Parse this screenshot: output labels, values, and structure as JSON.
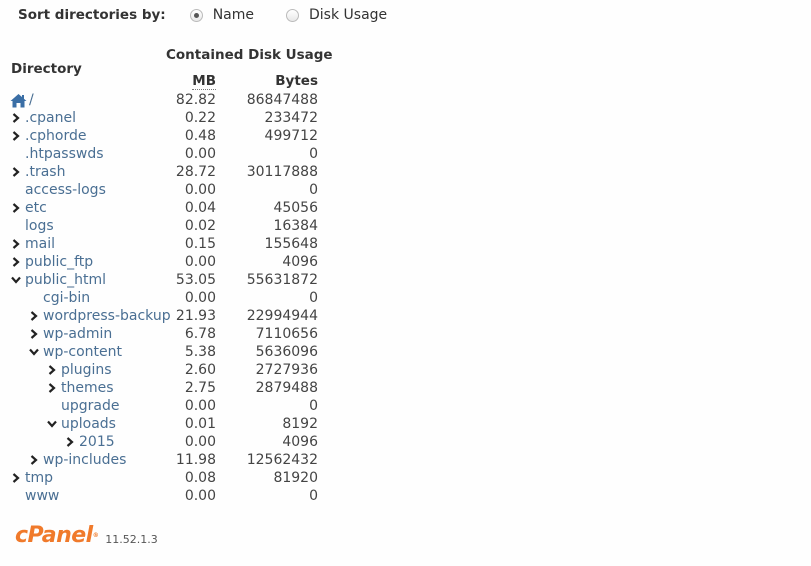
{
  "sort": {
    "label": "Sort directories by:",
    "options": [
      {
        "label": "Name",
        "checked": true
      },
      {
        "label": "Disk Usage",
        "checked": false
      }
    ]
  },
  "table": {
    "header_directory": "Directory",
    "header_group": "Contained Disk Usage",
    "header_mb": "MB",
    "header_bytes": "Bytes",
    "rows": [
      {
        "name": "/",
        "level": 0,
        "toggle": "home",
        "mb": "82.82",
        "bytes": "86847488"
      },
      {
        "name": ".cpanel",
        "level": 0,
        "toggle": "collapsed",
        "mb": "0.22",
        "bytes": "233472"
      },
      {
        "name": ".cphorde",
        "level": 0,
        "toggle": "collapsed",
        "mb": "0.48",
        "bytes": "499712"
      },
      {
        "name": ".htpasswds",
        "level": 0,
        "toggle": "none",
        "mb": "0.00",
        "bytes": "0"
      },
      {
        "name": ".trash",
        "level": 0,
        "toggle": "collapsed",
        "mb": "28.72",
        "bytes": "30117888"
      },
      {
        "name": "access-logs",
        "level": 0,
        "toggle": "none",
        "mb": "0.00",
        "bytes": "0"
      },
      {
        "name": "etc",
        "level": 0,
        "toggle": "collapsed",
        "mb": "0.04",
        "bytes": "45056"
      },
      {
        "name": "logs",
        "level": 0,
        "toggle": "none",
        "mb": "0.02",
        "bytes": "16384"
      },
      {
        "name": "mail",
        "level": 0,
        "toggle": "collapsed",
        "mb": "0.15",
        "bytes": "155648"
      },
      {
        "name": "public_ftp",
        "level": 0,
        "toggle": "collapsed",
        "mb": "0.00",
        "bytes": "4096"
      },
      {
        "name": "public_html",
        "level": 0,
        "toggle": "expanded",
        "mb": "53.05",
        "bytes": "55631872"
      },
      {
        "name": "cgi-bin",
        "level": 1,
        "toggle": "none",
        "mb": "0.00",
        "bytes": "0"
      },
      {
        "name": "wordpress-backup",
        "level": 1,
        "toggle": "collapsed",
        "mb": "21.93",
        "bytes": "22994944"
      },
      {
        "name": "wp-admin",
        "level": 1,
        "toggle": "collapsed",
        "mb": "6.78",
        "bytes": "7110656"
      },
      {
        "name": "wp-content",
        "level": 1,
        "toggle": "expanded",
        "mb": "5.38",
        "bytes": "5636096"
      },
      {
        "name": "plugins",
        "level": 2,
        "toggle": "collapsed",
        "mb": "2.60",
        "bytes": "2727936"
      },
      {
        "name": "themes",
        "level": 2,
        "toggle": "collapsed",
        "mb": "2.75",
        "bytes": "2879488"
      },
      {
        "name": "upgrade",
        "level": 2,
        "toggle": "none",
        "mb": "0.00",
        "bytes": "0"
      },
      {
        "name": "uploads",
        "level": 2,
        "toggle": "expanded",
        "mb": "0.01",
        "bytes": "8192"
      },
      {
        "name": "2015",
        "level": 3,
        "toggle": "collapsed",
        "mb": "0.00",
        "bytes": "4096"
      },
      {
        "name": "wp-includes",
        "level": 1,
        "toggle": "collapsed",
        "mb": "11.98",
        "bytes": "12562432"
      },
      {
        "name": "tmp",
        "level": 0,
        "toggle": "collapsed",
        "mb": "0.08",
        "bytes": "81920"
      },
      {
        "name": "www",
        "level": 0,
        "toggle": "none",
        "mb": "0.00",
        "bytes": "0"
      }
    ]
  },
  "footer": {
    "logo_text": "cPanel",
    "version": "11.52.1.3",
    "brand_color": "#f07a2b"
  },
  "colors": {
    "link": "#4a6f93",
    "home_icon": "#3a6ea5"
  }
}
